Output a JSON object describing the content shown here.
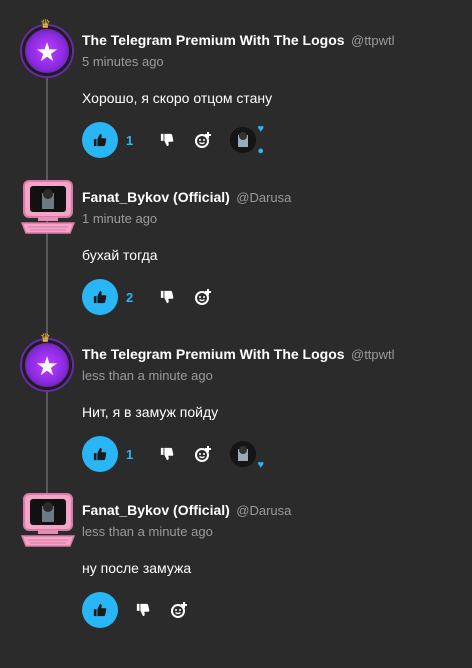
{
  "comments": [
    {
      "author": "The Telegram Premium With The Logos",
      "handle": "@ttpwtl",
      "time": "5 minutes ago",
      "text": "Хорошо, я скоро отцом стану",
      "likes": "1",
      "avatar_icon": "star-icon"
    },
    {
      "author": "Fanat_Bykov (Official)",
      "handle": "@Darusa",
      "time": "1 minute ago",
      "text": "бухай тогда",
      "likes": "2",
      "avatar_icon": "pink-computer-icon"
    },
    {
      "author": "The Telegram Premium With The Logos",
      "handle": "@ttpwtl",
      "time": "less than a minute ago",
      "text": "Нит, я в замуж пойду",
      "likes": "1",
      "avatar_icon": "star-icon"
    },
    {
      "author": "Fanat_Bykov (Official)",
      "handle": "@Darusa",
      "time": "less than a minute ago",
      "text": "ну после замужа",
      "likes": "",
      "avatar_icon": "pink-computer-icon"
    }
  ],
  "colors": {
    "background": "#2b2b2b",
    "accent": "#29b6f6",
    "muted": "#9a9a9a"
  }
}
